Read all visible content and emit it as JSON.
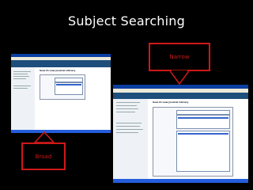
{
  "slide": {
    "title": "Subject Searching"
  },
  "callouts": {
    "narrow": "Narrow",
    "broad": "Broad"
  },
  "colors": {
    "background": "#000000",
    "callout": "#d01818",
    "title": "#ffffff",
    "browser_titlebar": "#0b3ea1"
  },
  "screenshots": {
    "small": {
      "heading": "Search Law Journal Library"
    },
    "large": {
      "heading": "Search Law Journal Library"
    }
  }
}
